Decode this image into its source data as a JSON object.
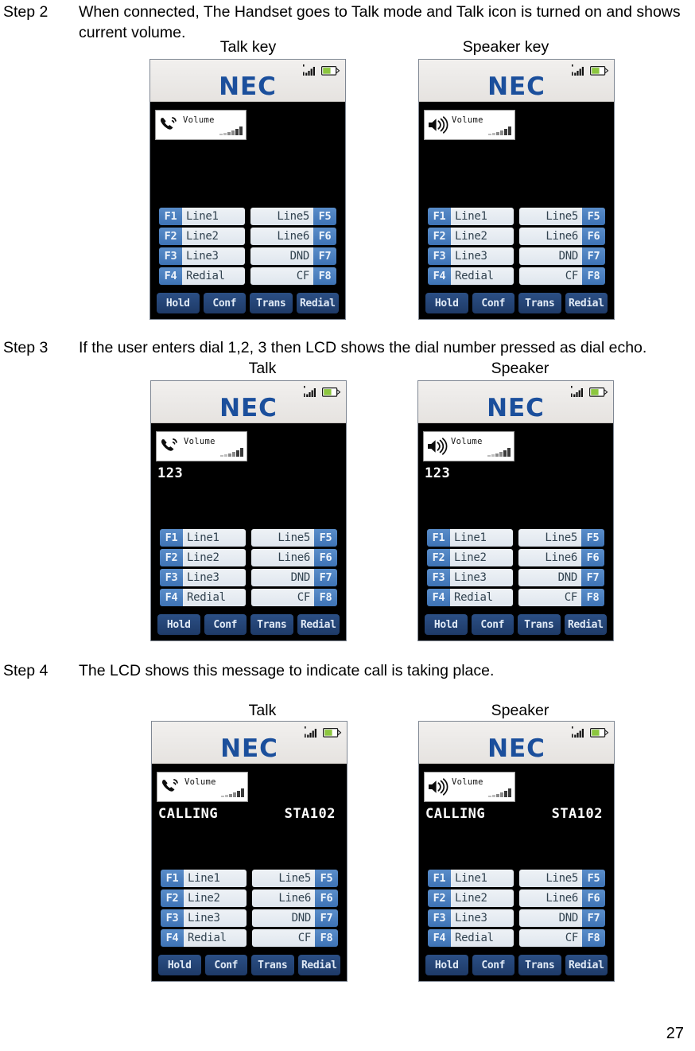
{
  "page": {
    "number": "27"
  },
  "steps": [
    {
      "label": "Step 2",
      "text": "When connected, The Handset goes to Talk mode and Talk icon is turned on and shows current volume."
    },
    {
      "label": "Step 3",
      "text": "If the user enters dial 1,2, 3 then LCD shows the dial number pressed as dial echo."
    },
    {
      "label": "Step 4",
      "text": "The LCD shows this message to indicate call is taking place."
    }
  ],
  "captions": {
    "row1_left": "Talk key",
    "row1_right": "Speaker key",
    "row2_left": "Talk",
    "row2_right": "Speaker",
    "row3_left": "Talk",
    "row3_right": "Speaker"
  },
  "phone": {
    "brand": "NEC",
    "volume_label": "Volume",
    "volume_meter_levels": [
      2,
      3,
      4,
      6,
      8,
      11
    ],
    "status": {
      "signal_icon": "signal-strength-icon",
      "battery_icon": "battery-icon"
    },
    "function_keys_left": [
      {
        "tag": "F1",
        "name": "Line1"
      },
      {
        "tag": "F2",
        "name": "Line2"
      },
      {
        "tag": "F3",
        "name": "Line3"
      },
      {
        "tag": "F4",
        "name": "Redial"
      }
    ],
    "function_keys_right": [
      {
        "tag": "F5",
        "name": "Line5"
      },
      {
        "tag": "F6",
        "name": "Line6"
      },
      {
        "tag": "F7",
        "name": "DND"
      },
      {
        "tag": "F8",
        "name": "CF"
      }
    ],
    "soft_keys": [
      "Hold",
      "Conf",
      "Trans",
      "Redial"
    ]
  },
  "screens": {
    "step2_talk": {
      "mode": "handset",
      "message_left": "",
      "message_right": ""
    },
    "step2_speaker": {
      "mode": "speaker",
      "message_left": "",
      "message_right": ""
    },
    "step3_talk": {
      "mode": "handset",
      "message_left": "123",
      "message_right": ""
    },
    "step3_speaker": {
      "mode": "speaker",
      "message_left": "123",
      "message_right": ""
    },
    "step4_talk": {
      "mode": "handset",
      "message_left": "CALLING",
      "message_right": "STA102"
    },
    "step4_speaker": {
      "mode": "speaker",
      "message_left": "CALLING",
      "message_right": "STA102"
    }
  },
  "colors": {
    "nec_blue": "#1b4f9c",
    "lcd_black": "#000000",
    "fkey_blue": "#3e73b5",
    "softkey_blue": "#1e3a67",
    "battery_green": "#8cc63f"
  }
}
